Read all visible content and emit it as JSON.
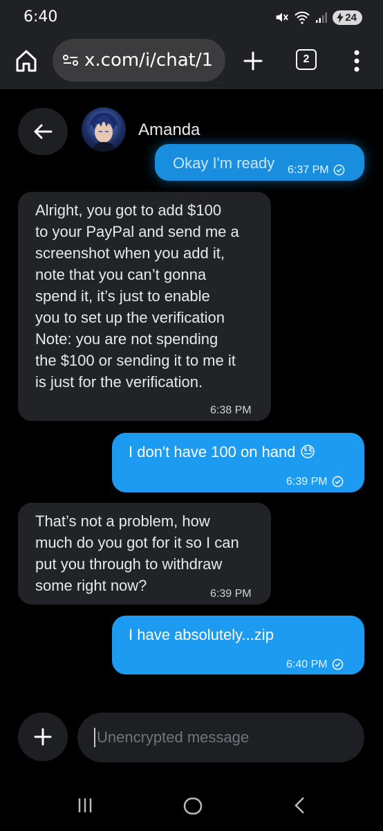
{
  "status_bar": {
    "time": "6:40",
    "battery": "24"
  },
  "browser": {
    "url": "x.com/i/chat/1",
    "tab_count": "2"
  },
  "chat": {
    "contact_name": "Amanda",
    "messages": [
      {
        "direction": "sent",
        "text": "Okay I'm ready",
        "time": "6:37 PM",
        "read": true
      },
      {
        "direction": "received",
        "text": "Alright, you got to add $100\nto your PayPal and send me a\nscreenshot when you add it,\nnote that you can’t gonna\nspend it, it’s just to enable\nyou to set up the verification\nNote: you are not spending\nthe $100 or sending it to me it\nis just for the verification.",
        "time": "6:38 PM"
      },
      {
        "direction": "sent",
        "text": "I don't have 100 on hand 😓",
        "time": "6:39 PM",
        "read": true
      },
      {
        "direction": "received",
        "text": "That’s not a problem, how\nmuch do you got for it so I can\nput you through to withdraw\nsome right now?",
        "time": "6:39 PM"
      },
      {
        "direction": "sent",
        "text": "I have absolutely...zip",
        "time": "6:40 PM",
        "read": true
      }
    ]
  },
  "compose": {
    "placeholder": "Unencrypted message"
  }
}
